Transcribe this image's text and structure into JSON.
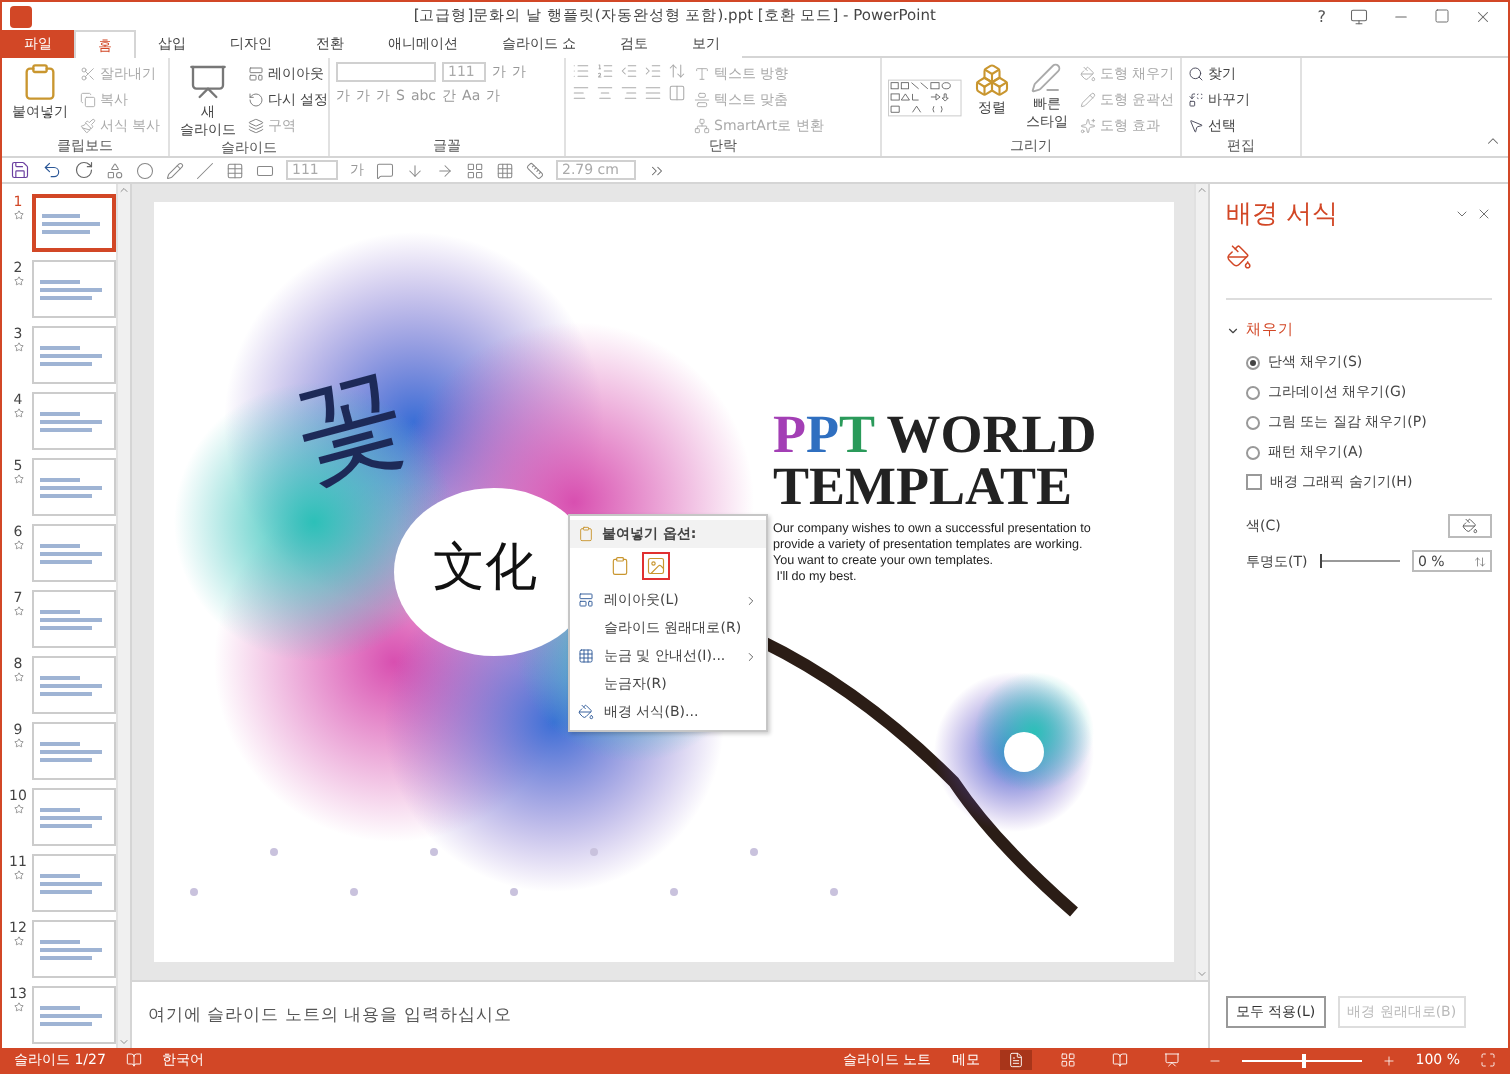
{
  "window": {
    "title": "[고급형]문화의 날 행플릿(자동완성형 포함).ppt [호환 모드] - PowerPoint",
    "help": "?"
  },
  "ribbon_tabs": [
    {
      "label": "파일",
      "kind": "file",
      "selected": false
    },
    {
      "label": "홈",
      "kind": "tab",
      "selected": true
    },
    {
      "label": "삽입",
      "kind": "tab",
      "selected": false
    },
    {
      "label": "디자인",
      "kind": "tab",
      "selected": false
    },
    {
      "label": "전환",
      "kind": "tab",
      "selected": false
    },
    {
      "label": "애니메이션",
      "kind": "tab",
      "selected": false
    },
    {
      "label": "슬라이드 쇼",
      "kind": "tab",
      "selected": false
    },
    {
      "label": "검토",
      "kind": "tab",
      "selected": false
    },
    {
      "label": "보기",
      "kind": "tab",
      "selected": false
    }
  ],
  "ribbon": {
    "clipboard": {
      "label": "클립보드",
      "paste": "붙여넣기",
      "items": [
        {
          "label": "잘라내기",
          "disabled": true
        },
        {
          "label": "복사",
          "disabled": true
        },
        {
          "label": "서식 복사",
          "disabled": true
        }
      ]
    },
    "slides": {
      "label": "슬라이드",
      "new_slide": "새 슬라이드",
      "items": [
        {
          "label": "레이아웃",
          "disabled": false
        },
        {
          "label": "다시 설정",
          "disabled": false
        },
        {
          "label": "구역",
          "disabled": true
        }
      ]
    },
    "font": {
      "label": "글꼴",
      "size": "111",
      "row_1": [
        "가",
        "가"
      ],
      "row_2": [
        "가",
        "가",
        "가",
        "S",
        "abc",
        "간",
        "Aa",
        "가"
      ]
    },
    "paragraph": {
      "label": "단락",
      "items": [
        {
          "label": "텍스트 방향",
          "disabled": true
        },
        {
          "label": "텍스트 맞춤",
          "disabled": true
        },
        {
          "label": "SmartArt로 변환",
          "disabled": true
        }
      ]
    },
    "drawing": {
      "label": "그리기",
      "arrange": "정렬",
      "quick_styles": "빠른 스타일",
      "items": [
        {
          "label": "도형 채우기",
          "disabled": true
        },
        {
          "label": "도형 윤곽선",
          "disabled": true
        },
        {
          "label": "도형 효과",
          "disabled": true
        }
      ]
    },
    "editing": {
      "label": "편집",
      "items": [
        {
          "label": "찾기"
        },
        {
          "label": "바꾸기"
        },
        {
          "label": "선택"
        }
      ]
    }
  },
  "quick_toolbar": {
    "size": "111",
    "font_color": "가",
    "width": "2.79 cm"
  },
  "thumbnails": [
    {
      "number": "1",
      "selected": true
    },
    {
      "number": "2",
      "selected": false
    },
    {
      "number": "3",
      "selected": false
    },
    {
      "number": "4",
      "selected": false
    },
    {
      "number": "5",
      "selected": false
    },
    {
      "number": "6",
      "selected": false
    },
    {
      "number": "7",
      "selected": false
    },
    {
      "number": "8",
      "selected": false
    },
    {
      "number": "9",
      "selected": false
    },
    {
      "number": "10",
      "selected": false
    },
    {
      "number": "11",
      "selected": false
    },
    {
      "number": "12",
      "selected": false
    },
    {
      "number": "13",
      "selected": false
    }
  ],
  "slide": {
    "calligraphy_1": "꽃",
    "calligraphy_2": "文化",
    "title_letters": [
      {
        "text": "P",
        "color": "#a33fb5"
      },
      {
        "text": "P",
        "color": "#2f6fc0"
      },
      {
        "text": "T",
        "color": "#2a9a5a"
      }
    ],
    "title_rest": "WORLD",
    "title_line_2": "TEMPLATE",
    "body": "Our company wishes to own a successful presentation to\nprovide a variety of presentation templates are working.\nYou want to create your own templates.\n I'll do my best."
  },
  "context_menu": {
    "header": "붙여넣기 옵션:",
    "paste_options": [
      {
        "selected": false
      },
      {
        "selected": true
      }
    ],
    "items": [
      {
        "label": "레이아웃(L)",
        "submenu": true
      },
      {
        "label": "슬라이드 원래대로(R)",
        "submenu": false
      },
      {
        "label": "눈금 및 안내선(I)...",
        "submenu": true
      },
      {
        "label": "눈금자(R)",
        "submenu": false
      },
      {
        "label": "배경 서식(B)...",
        "submenu": false
      }
    ]
  },
  "notes": {
    "placeholder": "여기에 슬라이드 노트의 내용을 입력하십시오"
  },
  "format_pane": {
    "title": "배경 서식",
    "section": {
      "label": "채우기",
      "expanded": true
    },
    "options": [
      {
        "label": "단색 채우기(S)",
        "selected": true
      },
      {
        "label": "그라데이션 채우기(G)",
        "selected": false
      },
      {
        "label": "그림 또는 질감 채우기(P)",
        "selected": false
      },
      {
        "label": "패턴 채우기(A)",
        "selected": false
      }
    ],
    "hide_graphics": {
      "label": "배경 그래픽 숨기기(H)",
      "checked": false
    },
    "color_label": "색(C)",
    "transparency_label": "투명도(T)",
    "transparency": {
      "level": 0,
      "value": "0 %"
    },
    "buttons": [
      {
        "label": "모두 적용(L)",
        "disabled": false
      },
      {
        "label": "배경 원래대로(B)",
        "disabled": true
      }
    ]
  },
  "status_bar": {
    "slide": "슬라이드 1/27",
    "language": "한국어",
    "notes": "슬라이드 노트",
    "comments": "메모",
    "views": [
      {
        "selected": true
      },
      {
        "selected": false
      },
      {
        "selected": false
      },
      {
        "selected": false
      }
    ],
    "zoom": {
      "level": 0.5,
      "value": "100 %"
    }
  }
}
